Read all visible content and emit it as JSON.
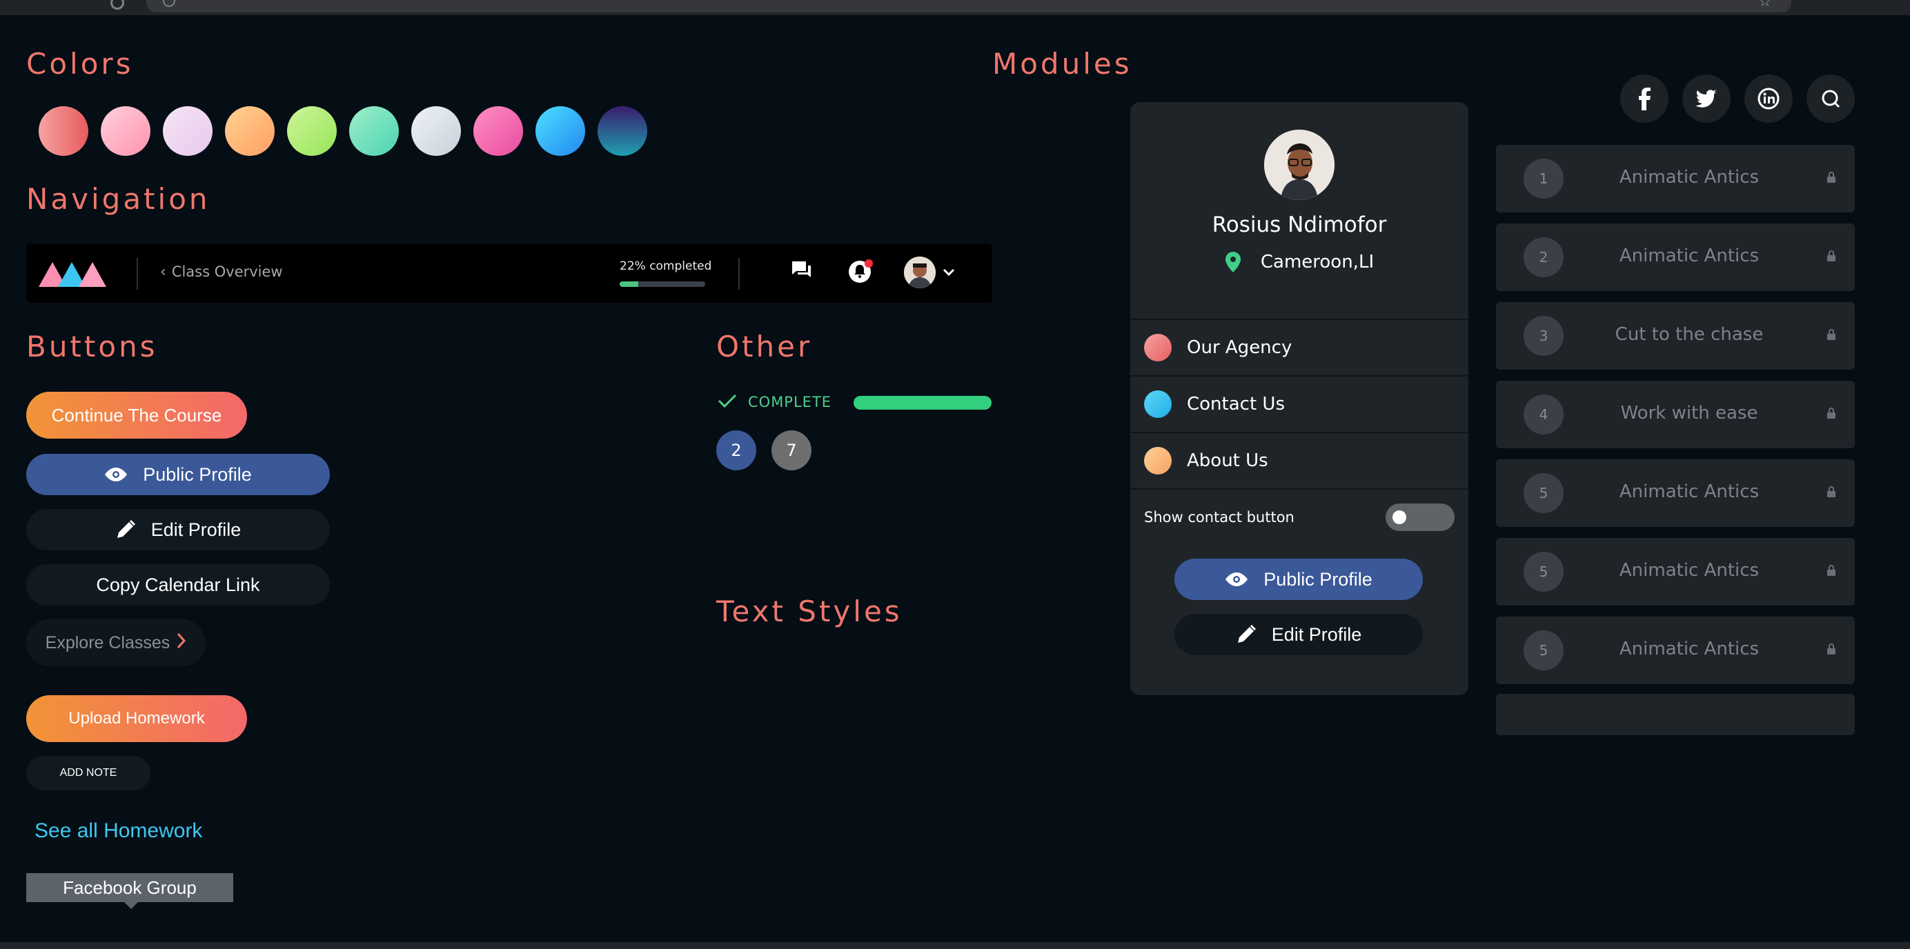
{
  "sections": {
    "colors": "Colors",
    "navigation": "Navigation",
    "buttons": "Buttons",
    "other": "Other",
    "text_styles": "Text Styles",
    "modules": "Modules"
  },
  "palette": [
    "#ef8080",
    "#ffb3c6",
    "#f2daf2",
    "#ffbe7a",
    "#b5f07a",
    "#7de4c0",
    "#dfe6ec",
    "#ff6fb0",
    "#22b8f5",
    "#2b2060"
  ],
  "nav": {
    "back_label": "Class Overview",
    "progress_label": "22% completed",
    "progress_value": 0.22
  },
  "buttons": {
    "continue": "Continue The Course",
    "public_profile": "Public Profile",
    "edit_profile": "Edit Profile",
    "copy_calendar": "Copy Calendar Link",
    "explore": "Explore Classes",
    "upload": "Upload Homework",
    "add_note": "ADD NOTE",
    "see_all": "See all Homework",
    "facebook_group": "Facebook Group"
  },
  "other": {
    "complete_label": "COMPLETE",
    "badges": [
      "2",
      "7"
    ]
  },
  "profile": {
    "name": "Rosius Ndimofor",
    "location": "Cameroon,LI",
    "menu": [
      {
        "label": "Our Agency",
        "color": "#ef7f7f"
      },
      {
        "label": "Contact Us",
        "color": "#2ec4f2"
      },
      {
        "label": "About Us",
        "color": "#ffbc78"
      }
    ],
    "toggle_label": "Show contact button",
    "toggle_on": false,
    "public_profile": "Public Profile",
    "edit_profile": "Edit Profile"
  },
  "social": [
    "facebook-icon",
    "twitter-icon",
    "linkedin-icon",
    "search-icon"
  ],
  "lessons": [
    {
      "num": "1",
      "title": "Animatic Antics"
    },
    {
      "num": "2",
      "title": "Animatic Antics"
    },
    {
      "num": "3",
      "title": "Cut to the chase"
    },
    {
      "num": "4",
      "title": "Work with ease"
    },
    {
      "num": "5",
      "title": "Animatic Antics"
    },
    {
      "num": "5",
      "title": "Animatic Antics"
    },
    {
      "num": "5",
      "title": "Animatic Antics"
    }
  ]
}
